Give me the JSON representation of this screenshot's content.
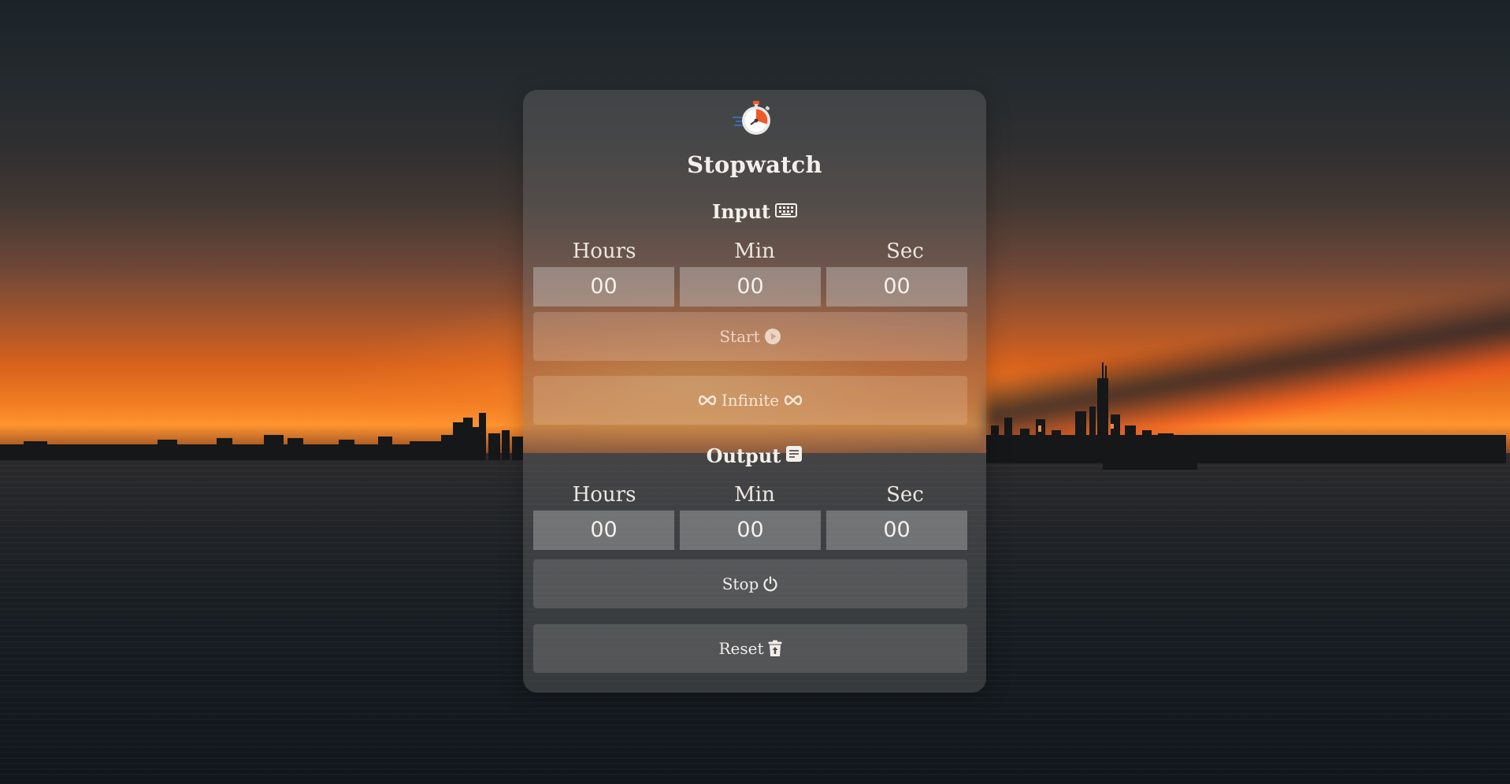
{
  "app": {
    "title": "Stopwatch",
    "logo_icon": "stopwatch-icon"
  },
  "input": {
    "heading": "Input",
    "heading_icon": "keyboard-icon",
    "labels": [
      "Hours",
      "Min",
      "Sec"
    ],
    "values": {
      "hours": "00",
      "min": "00",
      "sec": "00"
    }
  },
  "buttons": {
    "start": {
      "label": "Start",
      "icon": "play-circle-icon"
    },
    "infinite": {
      "label": "Infinite",
      "icon": "infinity-icon"
    },
    "stop": {
      "label": "Stop",
      "icon": "power-icon"
    },
    "reset": {
      "label": "Reset",
      "icon": "trash-restore-icon"
    }
  },
  "output": {
    "heading": "Output",
    "heading_icon": "document-icon",
    "labels": [
      "Hours",
      "Min",
      "Sec"
    ],
    "values": {
      "hours": "00",
      "min": "00",
      "sec": "00"
    }
  },
  "colors": {
    "text": "#f1eeeb",
    "accent_orange": "#f05a28",
    "accent_blue": "#3a6fb5"
  }
}
